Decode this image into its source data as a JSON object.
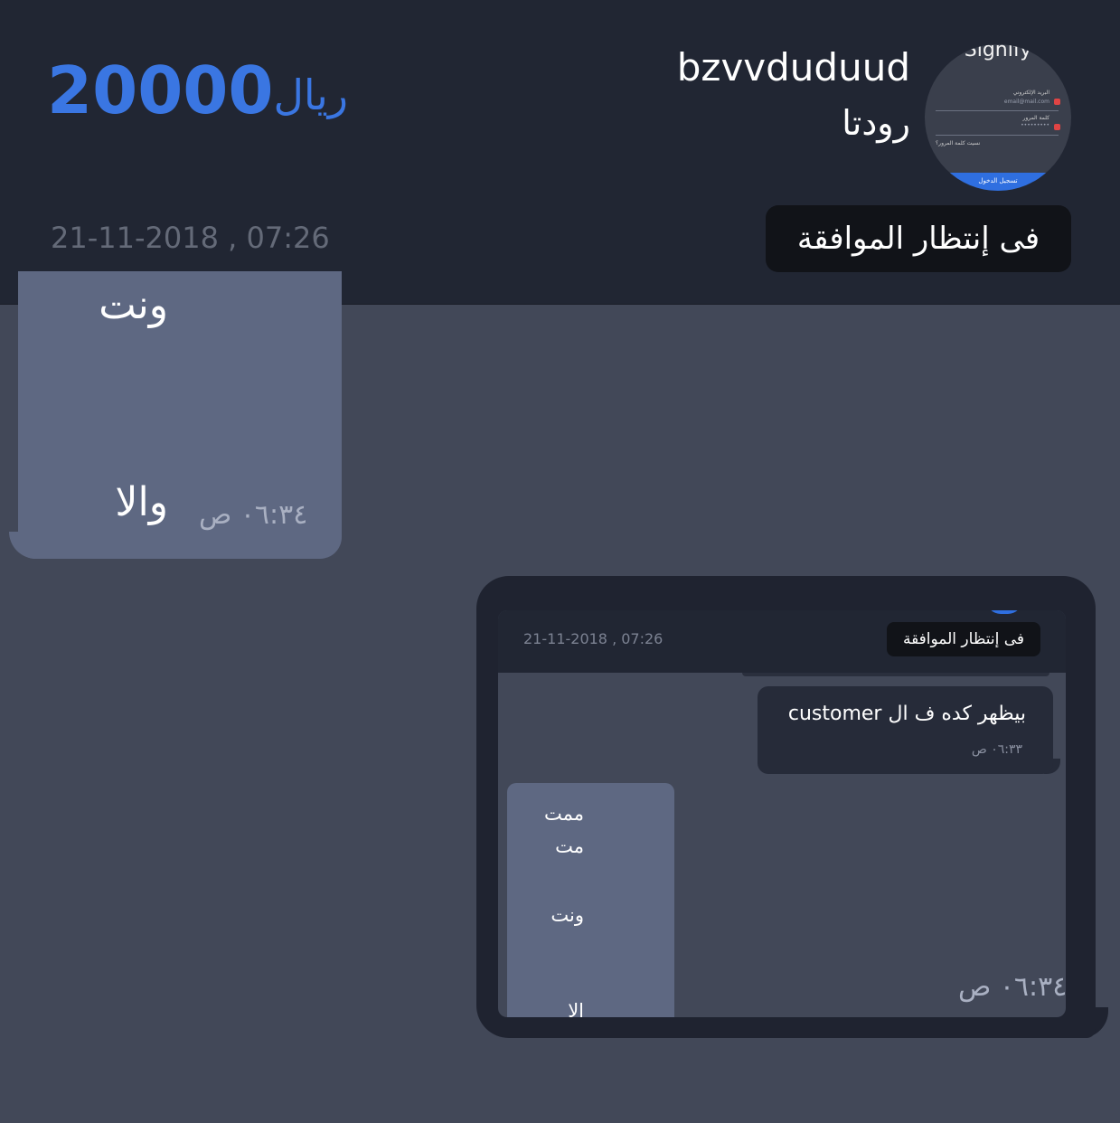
{
  "header": {
    "price_amount": "20000",
    "price_currency": "ريال",
    "username": "bzvvduduud",
    "product_name": "رودتا",
    "status": "فى إنتظار الموافقة",
    "date": "21-11-2018 , 07:26",
    "avatar": {
      "title": "Signify",
      "email_label": "البريد الإلكتروني",
      "email_value": "email@mail.com",
      "password_label": "كلمة المرور",
      "password_value": "•••••••••",
      "forgot_label": "نسيت كلمة المرور؟",
      "login_label": "تسجيل الدخول"
    }
  },
  "messages": {
    "incoming": {
      "cut_text": "ونت",
      "text": "والا",
      "time": "٠٦:٣٤ ص"
    },
    "outgoing": {
      "time": "٠٦:٣٤ ص",
      "screenshot": {
        "date": "21-11-2018 , 07:26",
        "status": "فى إنتظار الموافقة",
        "message_text": "بيظهر كده ف ال customer",
        "message_time": "٠٦:٣٣ ص",
        "incoming_lines": [
          "ممت",
          "مت",
          "ونت",
          "الا"
        ]
      }
    }
  }
}
